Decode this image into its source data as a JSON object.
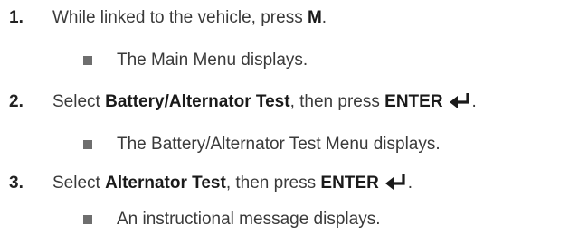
{
  "steps": [
    {
      "number": "1.",
      "prefix": "While linked to the vehicle, press ",
      "bold": "M",
      "suffix": ".",
      "enter_key": false,
      "result": "The Main Menu displays."
    },
    {
      "number": "2.",
      "prefix": "Select ",
      "bold": "Battery/Alternator Test",
      "middle": ", then press ",
      "key": "ENTER",
      "suffix": ".",
      "enter_key": true,
      "result": "The Battery/Alternator Test Menu displays."
    },
    {
      "number": "3.",
      "prefix": "Select ",
      "bold": "Alternator Test",
      "middle": ", then press ",
      "key": "ENTER",
      "suffix": ".",
      "enter_key": true,
      "result": "An instructional message displays."
    }
  ],
  "icons": {
    "enter": "enter-key-icon",
    "bullet": "square-bullet-icon"
  },
  "colors": {
    "text": "#3a3a3a",
    "bullet": "#6e6e6e"
  }
}
